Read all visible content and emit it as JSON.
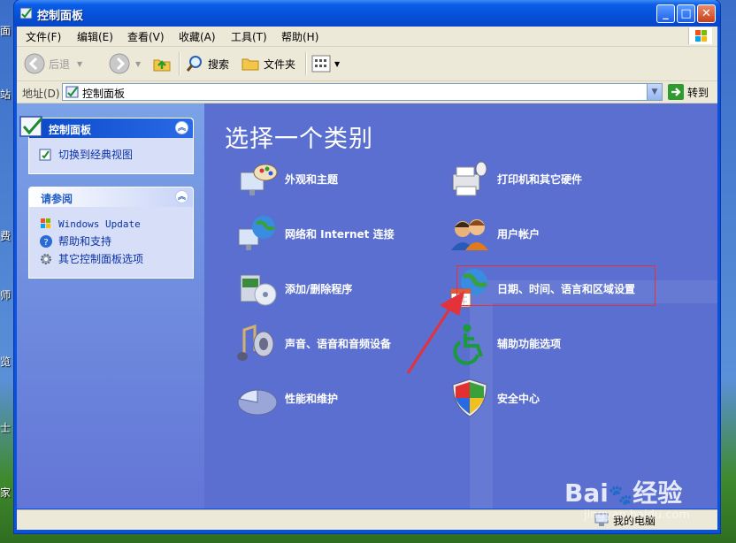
{
  "window": {
    "title": "控制面板"
  },
  "menubar": {
    "items": [
      "文件(F)",
      "编辑(E)",
      "查看(V)",
      "收藏(A)",
      "工具(T)",
      "帮助(H)"
    ]
  },
  "toolbar": {
    "back": "后退",
    "search": "搜索",
    "folders": "文件夹"
  },
  "address": {
    "label": "地址(D)",
    "value": "控制面板",
    "go": "转到"
  },
  "sidebar": {
    "control_panel_box": {
      "title": "控制面板",
      "switch_link": "切换到经典视图"
    },
    "see_also_box": {
      "title": "请参阅",
      "links": [
        "Windows Update",
        "帮助和支持",
        "其它控制面板选项"
      ]
    }
  },
  "main": {
    "title": "选择一个类别",
    "categories": [
      "外观和主题",
      "打印机和其它硬件",
      "网络和 Internet 连接",
      "用户帐户",
      "添加/删除程序",
      "日期、时间、语言和区域设置",
      "声音、语音和音频设备",
      "辅助功能选项",
      "性能和维护",
      "安全中心"
    ],
    "highlighted_category": "日期、时间、语言和区域设置"
  },
  "statusbar": {
    "text": "我的电脑"
  },
  "desktop": {
    "left_labels": [
      "面",
      "站",
      "费",
      "师",
      "览",
      "士",
      "家"
    ]
  },
  "watermark": {
    "brand": "Bai",
    "brand2": "经验",
    "sub": "jingyan.baidu.com"
  },
  "colors": {
    "highlight_box": "#e3323a",
    "annotation_arrow": "#e3323a",
    "title_bar": "#0550d8"
  }
}
